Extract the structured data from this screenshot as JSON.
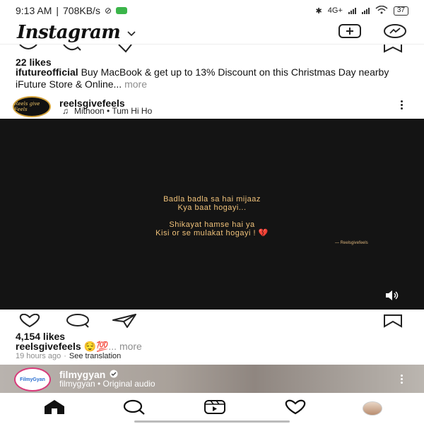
{
  "status_bar": {
    "time": "9:13 AM",
    "speed": "708KB/s",
    "network": "4G+",
    "battery": "37"
  },
  "header": {
    "logo": "Instagram"
  },
  "previous_post": {
    "likes": "22 likes",
    "username": "ifutureofficial",
    "caption": "Buy MacBook & get up to 13% Discount on this Christmas Day nearby iFuture Store & Online...",
    "more": "more"
  },
  "post": {
    "username": "reelsgivefeels",
    "avatar_text": "Reels give Feels",
    "audio": "Mithoon • Tum Hi Ho",
    "lyrics": [
      "Badla badla sa hai mijaaz",
      "Kya baat hogayi...",
      "Shikayat hamse hai ya",
      "Kisi or se mulakat hogayi ! 💔"
    ],
    "watermark": "— Reelsgivefeels",
    "likes": "4,154 likes",
    "caption_user": "reelsgivefeels",
    "caption_emoji": "😌💯",
    "more": "... more",
    "time_ago": "19 hours ago",
    "see_translation": "See translation"
  },
  "next_post": {
    "username": "filmygyan",
    "avatar_text": "FilmyGyan",
    "audio": "filmygyan • Original audio"
  },
  "nav": {
    "items": [
      "home",
      "search",
      "reels",
      "activity",
      "profile"
    ]
  }
}
